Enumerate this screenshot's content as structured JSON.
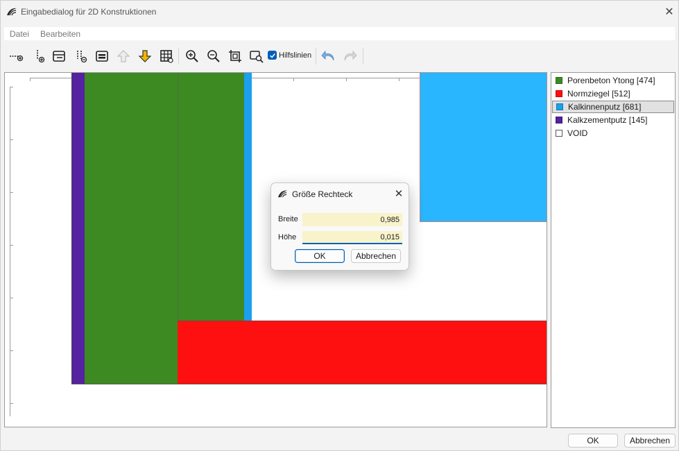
{
  "window": {
    "title": "Eingabedialog für 2D Konstruktionen",
    "close_glyph": "✕"
  },
  "menu": {
    "items": [
      "Datei",
      "Bearbeiten"
    ]
  },
  "toolbar": {
    "tools": [
      {
        "name": "add-line-horizontal-icon"
      },
      {
        "name": "add-line-vertical-icon"
      },
      {
        "name": "edit-layer-icon"
      },
      {
        "name": "split-vertical-icon"
      },
      {
        "name": "layer-properties-icon"
      },
      {
        "name": "move-up-icon"
      },
      {
        "name": "move-down-icon"
      },
      {
        "name": "grid-table-icon"
      },
      {
        "name": "zoom-in-icon"
      },
      {
        "name": "zoom-out-icon"
      },
      {
        "name": "zoom-fit-icon"
      },
      {
        "name": "zoom-window-icon"
      }
    ],
    "hilfslinien": {
      "label": "Hilfslinien",
      "checked": true
    },
    "undo": {
      "name": "undo-icon"
    },
    "redo": {
      "name": "redo-icon"
    }
  },
  "materials": [
    {
      "label": "Porenbeton Ytong [474]",
      "color": "#3d8a22"
    },
    {
      "label": "Normziegel [512]",
      "color": "#ff1010"
    },
    {
      "label": "Kalkinnenputz [681]",
      "color": "#1aa0ee",
      "selected": true
    },
    {
      "label": "Kalkzementputz [145]",
      "color": "#5522a0"
    },
    {
      "label": "VOID",
      "color": "#ffffff"
    }
  ],
  "dialog": {
    "title": "Größe Rechteck",
    "close_glyph": "✕",
    "breite": {
      "label": "Breite",
      "value": "0,985"
    },
    "hoehe": {
      "label": "Höhe",
      "value": "0,015"
    },
    "ok_label": "OK",
    "cancel_label": "Abbrechen"
  },
  "footer": {
    "ok_label": "OK",
    "cancel_label": "Abbrechen"
  }
}
